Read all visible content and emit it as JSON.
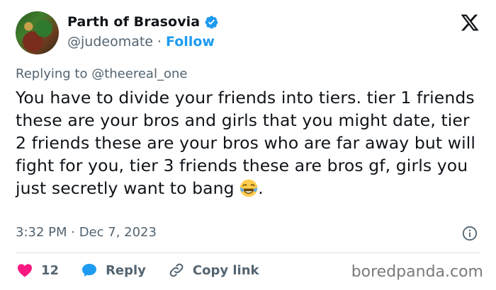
{
  "author": {
    "display_name": "Parth of Brasovia",
    "handle": "@judeomate",
    "separator": "·",
    "follow_label": "Follow"
  },
  "reply_to": {
    "prefix": "Replying to",
    "mention": "@theereal_one"
  },
  "tweet": {
    "text": "You have to divide your friends into tiers. tier 1 friends these are your bros and girls that you might date, tier 2 friends these are your bros who are far away but will fight for you, tier 3 friends these are bros gf, girls you just secretly want to bang",
    "emoji": "😂",
    "trailing": ".",
    "timestamp": "3:32 PM · Dec 7, 2023"
  },
  "actions": {
    "like_count": "12",
    "reply_label": "Reply",
    "copy_link_label": "Copy link"
  },
  "icons": {
    "verified": "verified-badge-icon",
    "x_logo": "x-logo-icon",
    "info": "info-icon",
    "heart": "heart-icon",
    "reply": "speech-bubble-icon",
    "link": "link-icon"
  },
  "colors": {
    "accent": "#1d9bf0",
    "like": "#f91880",
    "muted": "#536471"
  },
  "watermark": "boredpanda.com"
}
